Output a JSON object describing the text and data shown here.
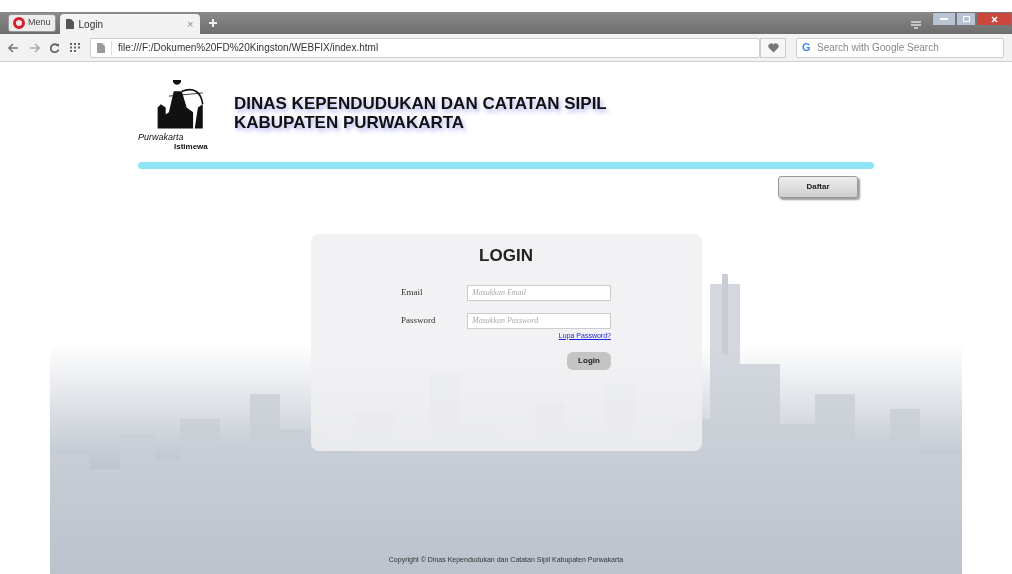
{
  "browser": {
    "menu_label": "Menu",
    "tabs": [
      {
        "title": "Login",
        "close": "×",
        "selected": true
      }
    ],
    "address": "file:///F:/Dokumen%20FD%20Kingston/WEBFIX/index.html",
    "search_engine_letter": "G",
    "search_placeholder": "Search with Google Search"
  },
  "header": {
    "logo_text": [
      "Purwakarta",
      "Istimewa"
    ],
    "title_lines": [
      "DINAS KEPENDUDUKAN DAN CATATAN SIPIL",
      "KABUPATEN PURWAKARTA"
    ]
  },
  "register_button": "Daftar",
  "login": {
    "title": "LOGIN",
    "fields": [
      {
        "label": "Email",
        "placeholder": "Masukkan Email"
      },
      {
        "label": "Password",
        "placeholder": "Masukkan Password"
      }
    ],
    "forgot_link": "Lupa Password?",
    "submit": "Login"
  },
  "footer": "Copyright © Dinas Kependudukan dan Catatan Sipil Kabupaten Purwakarta"
}
